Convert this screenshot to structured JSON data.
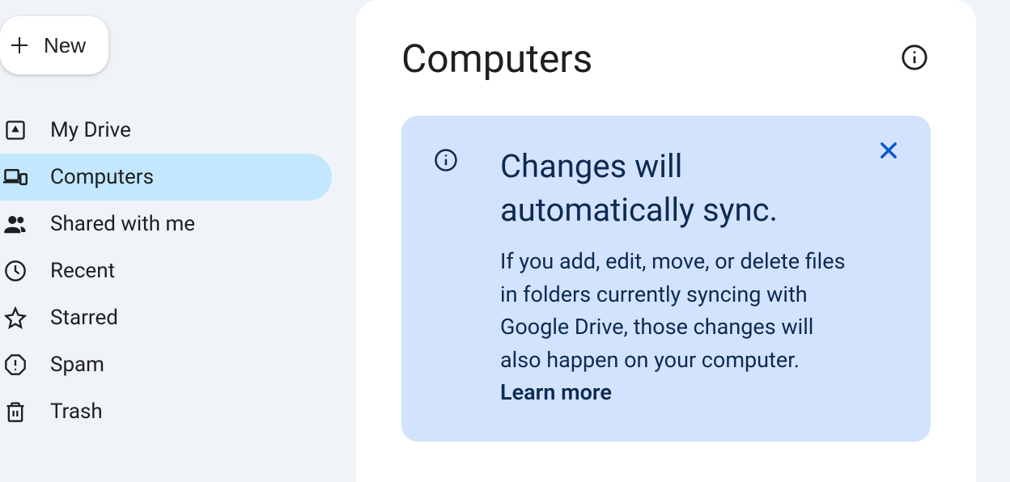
{
  "sidebar": {
    "new_label": "New",
    "items": [
      {
        "label": "My Drive",
        "icon": "drive"
      },
      {
        "label": "Computers",
        "icon": "devices",
        "selected": true
      },
      {
        "label": "Shared with me",
        "icon": "people"
      },
      {
        "label": "Recent",
        "icon": "clock"
      },
      {
        "label": "Starred",
        "icon": "star"
      },
      {
        "label": "Spam",
        "icon": "spam"
      },
      {
        "label": "Trash",
        "icon": "trash"
      }
    ]
  },
  "main": {
    "title": "Computers",
    "banner": {
      "headline": "Changes will automatically sync.",
      "body": "If you add, edit, move, or delete files in folders currently syncing with Google Drive, those changes will also happen on your computer. ",
      "link_text": "Learn more"
    }
  }
}
